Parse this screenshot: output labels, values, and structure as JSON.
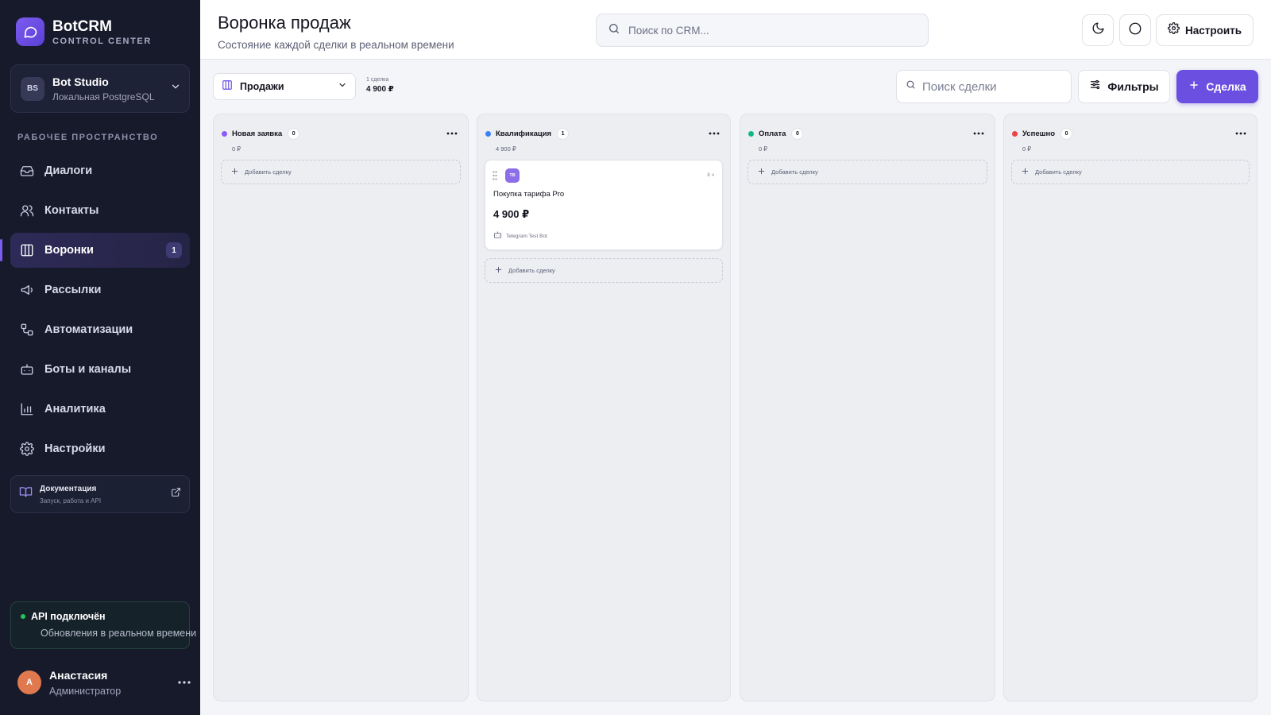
{
  "brand": {
    "name": "BotCRM",
    "subtitle": "CONTROL CENTER"
  },
  "workspace": {
    "initials": "BS",
    "name": "Bot Studio",
    "database": "Локальная PostgreSQL"
  },
  "sidebar": {
    "section_label": "РАБОЧЕЕ ПРОСТРАНСТВО",
    "items": [
      {
        "label": "Диалоги",
        "icon": "inbox-icon"
      },
      {
        "label": "Контакты",
        "icon": "users-icon"
      },
      {
        "label": "Воронки",
        "icon": "kanban-icon",
        "active": true,
        "badge": "1"
      },
      {
        "label": "Рассылки",
        "icon": "megaphone-icon"
      },
      {
        "label": "Автоматизации",
        "icon": "workflow-icon"
      },
      {
        "label": "Боты и каналы",
        "icon": "bot-icon"
      },
      {
        "label": "Аналитика",
        "icon": "bar-chart-icon"
      },
      {
        "label": "Настройки",
        "icon": "gear-icon"
      }
    ],
    "docs": {
      "title": "Документация",
      "subtitle": "Запуск, работа и API"
    },
    "api_status": {
      "title": "API подключён",
      "subtitle": "Обновления в реальном времени"
    },
    "user": {
      "initial": "А",
      "name": "Анастасия",
      "role": "Администратор"
    }
  },
  "header": {
    "title": "Воронка продаж",
    "subtitle": "Состояние каждой сделки в реальном времени",
    "search_placeholder": "Поиск по CRM...",
    "settings_label": "Настроить"
  },
  "toolbar": {
    "pipeline": "Продажи",
    "deal_count": "1 сделка",
    "total": "4 900 ₽",
    "search_placeholder": "Поиск сделки",
    "filters_label": "Фильтры",
    "new_deal_label": "Сделка"
  },
  "columns": [
    {
      "name": "Новая заявка",
      "count": "0",
      "sum": "0 ₽",
      "color": "#8b5cf6",
      "add_label": "Добавить сделку"
    },
    {
      "name": "Квалификация",
      "count": "1",
      "sum": "4 900 ₽",
      "color": "#3b82f6",
      "add_label": "Добавить сделку",
      "deal": {
        "initials": "TB",
        "time": "8 ч",
        "title": "Покупка тарифа Pro",
        "amount": "4 900 ₽",
        "source": "Telegram Test Bot"
      }
    },
    {
      "name": "Оплата",
      "count": "0",
      "sum": "0 ₽",
      "color": "#10b981",
      "add_label": "Добавить сделку"
    },
    {
      "name": "Успешно",
      "count": "0",
      "sum": "0 ₽",
      "color": "#ef4444",
      "add_label": "Добавить сделку"
    }
  ],
  "colors": {
    "accent": "#6a4fe0",
    "sidebar_bg": "#171a2b",
    "online": "#22c55e"
  }
}
